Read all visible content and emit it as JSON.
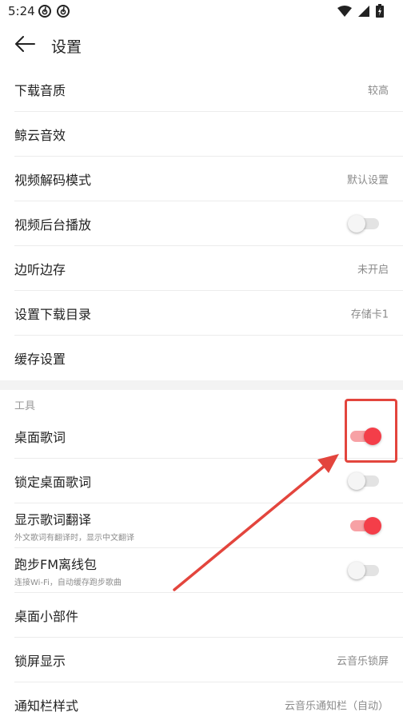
{
  "status_bar": {
    "time": "5:24"
  },
  "app_bar": {
    "title": "设置"
  },
  "settings": [
    {
      "label": "下载音质",
      "value": "较高"
    },
    {
      "label": "鲸云音效"
    },
    {
      "label": "视频解码模式",
      "value": "默认设置"
    },
    {
      "label": "视频后台播放",
      "toggle": false
    },
    {
      "label": "边听边存",
      "value": "未开启"
    },
    {
      "label": "设置下载目录",
      "value": "存储卡1"
    },
    {
      "label": "缓存设置"
    }
  ],
  "tools": {
    "header": "工具",
    "items": [
      {
        "label": "桌面歌词",
        "toggle": true
      },
      {
        "label": "锁定桌面歌词",
        "toggle": false
      },
      {
        "label": "显示歌词翻译",
        "sublabel": "外文歌词有翻译时，显示中文翻译",
        "toggle": true
      },
      {
        "label": "跑步FM离线包",
        "sublabel": "连接Wi-Fi，自动缓存跑步歌曲",
        "toggle": false
      },
      {
        "label": "桌面小部件"
      },
      {
        "label": "锁屏显示",
        "value": "云音乐锁屏"
      },
      {
        "label": "通知栏样式",
        "value": "云音乐通知栏（自动）"
      }
    ]
  },
  "colors": {
    "accent": "#f43e49",
    "annotation": "#e3453d"
  }
}
